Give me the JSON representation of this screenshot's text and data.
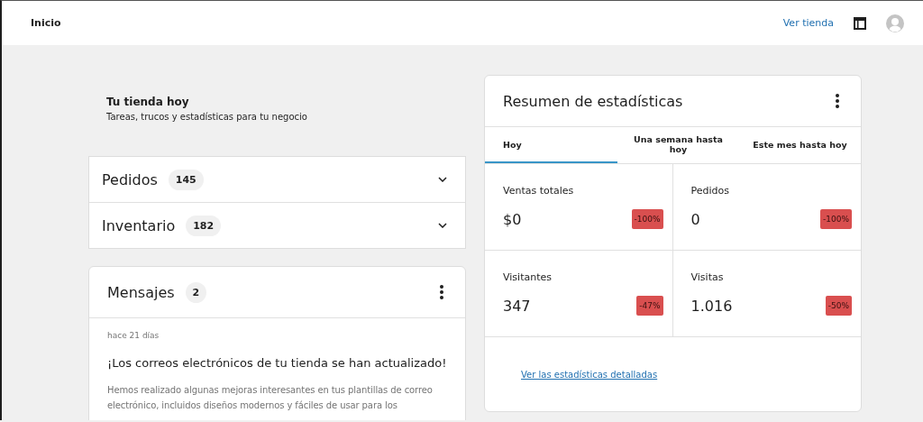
{
  "header": {
    "title": "Inicio",
    "link": "Ver tienda"
  },
  "intro": {
    "title": "Tu tienda hoy",
    "subtitle": "Tareas, trucos y estadísticas para tu negocio"
  },
  "accordion": [
    {
      "label": "Pedidos",
      "count": "145",
      "expanded": false
    },
    {
      "label": "Inventario",
      "count": "182",
      "expanded": false
    }
  ],
  "messages": {
    "title": "Mensajes",
    "count": "2",
    "items": [
      {
        "time": "hace 21 días",
        "title": "¡Los correos electrónicos de tu tienda se han actualizado!",
        "body": "Hemos realizado algunas mejoras interesantes en tus plantillas de correo electrónico, incluidos diseños modernos y fáciles de usar para los"
      }
    ]
  },
  "stats": {
    "title": "Resumen de estadísticas",
    "tabs": [
      {
        "label": "Hoy",
        "selected": true
      },
      {
        "label": "Una semana hasta hoy",
        "selected": false
      },
      {
        "label": "Este mes hasta hoy",
        "selected": false
      }
    ],
    "metrics": [
      {
        "label": "Ventas totales",
        "value": "$0",
        "delta": "-100%"
      },
      {
        "label": "Pedidos",
        "value": "0",
        "delta": "-100%"
      },
      {
        "label": "Visitantes",
        "value": "347",
        "delta": "-47%"
      },
      {
        "label": "Visitas",
        "value": "1.016",
        "delta": "-50%"
      }
    ],
    "link": "Ver las estadísticas detalladas"
  }
}
